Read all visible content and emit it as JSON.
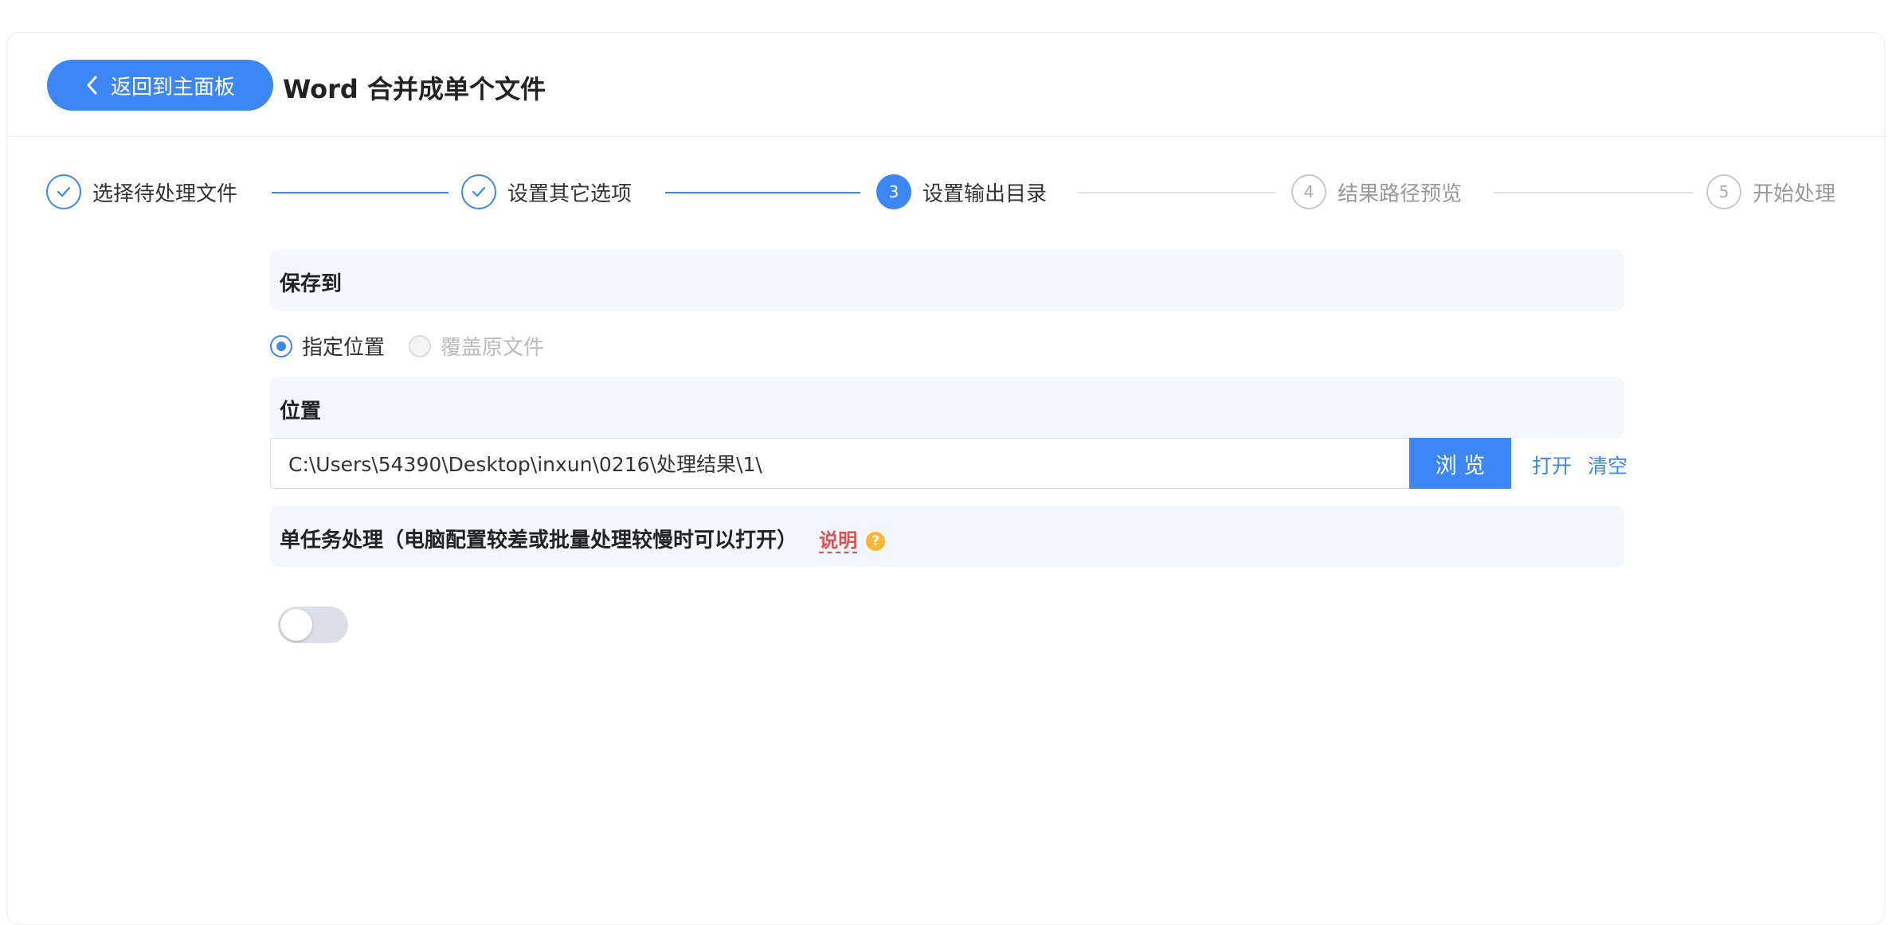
{
  "header": {
    "back_label": "返回到主面板",
    "title": "Word 合并成单个文件"
  },
  "steps": [
    {
      "num": "1",
      "label": "选择待处理文件",
      "state": "done"
    },
    {
      "num": "2",
      "label": "设置其它选项",
      "state": "done"
    },
    {
      "num": "3",
      "label": "设置输出目录",
      "state": "active"
    },
    {
      "num": "4",
      "label": "结果路径预览",
      "state": "todo"
    },
    {
      "num": "5",
      "label": "开始处理",
      "state": "todo"
    }
  ],
  "save_to": {
    "label": "保存到",
    "option_specified": "指定位置",
    "option_overwrite": "覆盖原文件",
    "selected": "指定位置"
  },
  "location": {
    "label": "位置",
    "path": "C:\\Users\\54390\\Desktop\\inxun\\0216\\处理结果\\1\\",
    "browse_label": "浏 览",
    "open_label": "打开",
    "clear_label": "清空"
  },
  "single_task": {
    "label": "单任务处理（电脑配置较差或批量处理较慢时可以打开）",
    "hint_label": "说明",
    "help_glyph": "?",
    "enabled": false
  },
  "colors": {
    "primary": "#3c86f5",
    "section_bg": "#f3f7fd",
    "hint": "#e05050",
    "help_icon": "#f5b82e"
  }
}
